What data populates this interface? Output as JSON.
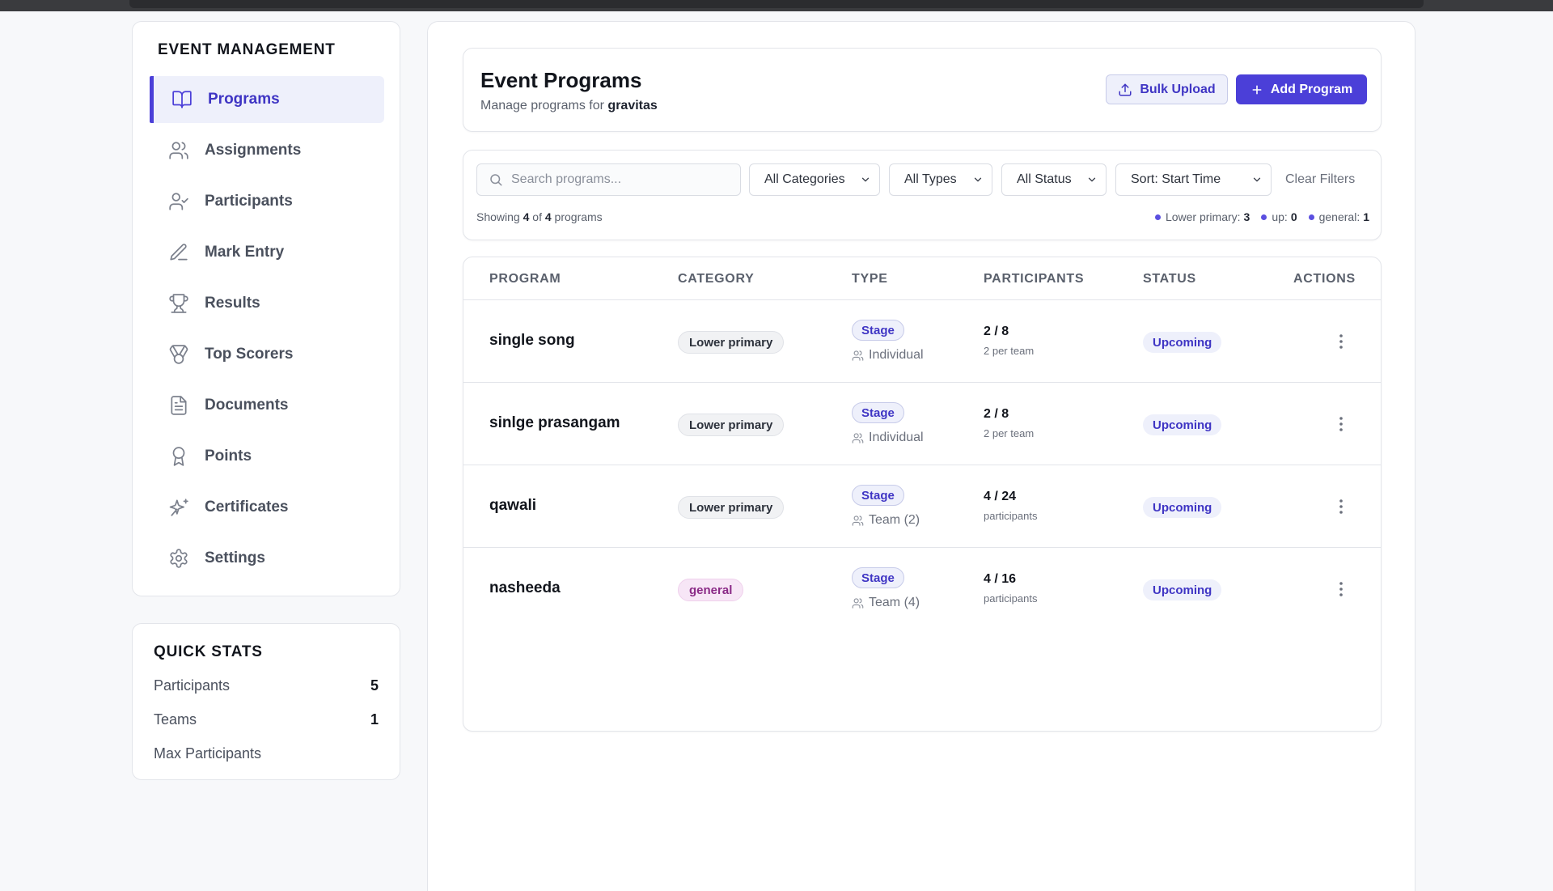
{
  "sidebar": {
    "heading": "EVENT MANAGEMENT",
    "items": [
      {
        "label": "Programs",
        "icon": "book-icon",
        "active": true
      },
      {
        "label": "Assignments",
        "icon": "users-icon"
      },
      {
        "label": "Participants",
        "icon": "user-check-icon"
      },
      {
        "label": "Mark Entry",
        "icon": "pen-icon"
      },
      {
        "label": "Results",
        "icon": "trophy-icon"
      },
      {
        "label": "Top Scorers",
        "icon": "medal-icon"
      },
      {
        "label": "Documents",
        "icon": "document-icon"
      },
      {
        "label": "Points",
        "icon": "award-icon"
      },
      {
        "label": "Certificates",
        "icon": "sparkles-icon"
      },
      {
        "label": "Settings",
        "icon": "gear-icon"
      }
    ]
  },
  "quick_stats": {
    "heading": "QUICK STATS",
    "rows": [
      {
        "label": "Participants",
        "value": "5"
      },
      {
        "label": "Teams",
        "value": "1"
      },
      {
        "label": "Max Participants",
        "value": ""
      }
    ]
  },
  "header": {
    "title": "Event Programs",
    "subtitle_prefix": "Manage programs for",
    "event_name": "gravitas",
    "bulk_upload_label": "Bulk Upload",
    "add_program_label": "Add Program"
  },
  "filters": {
    "search_placeholder": "Search programs...",
    "category": "All Categories",
    "type": "All Types",
    "status": "All Status",
    "sort": "Sort: Start Time",
    "clear_label": "Clear Filters",
    "showing_prefix": "Showing",
    "showing_count": "4",
    "showing_of": "of",
    "showing_total": "4",
    "showing_suffix": "programs",
    "legend": [
      {
        "label": "Lower primary:",
        "value": "3"
      },
      {
        "label": "up:",
        "value": "0"
      },
      {
        "label": "general:",
        "value": "1"
      }
    ]
  },
  "table": {
    "columns": [
      "PROGRAM",
      "CATEGORY",
      "TYPE",
      "PARTICIPANTS",
      "STATUS",
      "ACTIONS"
    ],
    "rows": [
      {
        "name": "single song",
        "category": "Lower primary",
        "category_style": "lower",
        "type": "Stage",
        "type_sub": "Individual",
        "participants": "2 / 8",
        "participants_sub": "2 per team",
        "status": "Upcoming"
      },
      {
        "name": "sinlge prasangam",
        "category": "Lower primary",
        "category_style": "lower",
        "type": "Stage",
        "type_sub": "Individual",
        "participants": "2 / 8",
        "participants_sub": "2 per team",
        "status": "Upcoming"
      },
      {
        "name": "qawali",
        "category": "Lower primary",
        "category_style": "lower",
        "type": "Stage",
        "type_sub": "Team (2)",
        "participants": "4 / 24",
        "participants_sub": "participants",
        "status": "Upcoming"
      },
      {
        "name": "nasheeda",
        "category": "general",
        "category_style": "general",
        "type": "Stage",
        "type_sub": "Team (4)",
        "participants": "4 / 16",
        "participants_sub": "participants",
        "status": "Upcoming"
      }
    ]
  },
  "colors": {
    "accent": "#4b3fd8",
    "accent_soft": "#eef0fb",
    "general_badge": "#f7e6f6"
  }
}
